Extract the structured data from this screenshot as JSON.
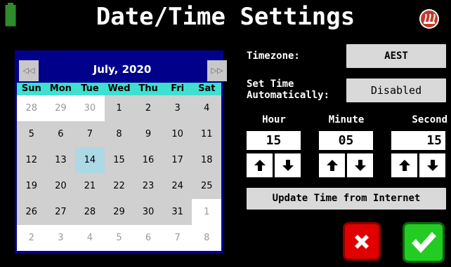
{
  "header": {
    "title": "Date/Time Settings",
    "battery_icon": "battery-icon",
    "logo_icon": "brand-logo-icon"
  },
  "calendar": {
    "month_label": "July, 2020",
    "prev_icon": "chevrons-left-icon",
    "next_icon": "chevrons-right-icon",
    "weekdays": [
      "Sun",
      "Mon",
      "Tue",
      "Wed",
      "Thu",
      "Fri",
      "Sat"
    ],
    "days": [
      {
        "d": "28",
        "other": true
      },
      {
        "d": "29",
        "other": true
      },
      {
        "d": "30",
        "other": true
      },
      {
        "d": "1"
      },
      {
        "d": "2"
      },
      {
        "d": "3"
      },
      {
        "d": "4"
      },
      {
        "d": "5"
      },
      {
        "d": "6"
      },
      {
        "d": "7"
      },
      {
        "d": "8"
      },
      {
        "d": "9"
      },
      {
        "d": "10"
      },
      {
        "d": "11"
      },
      {
        "d": "12"
      },
      {
        "d": "13"
      },
      {
        "d": "14",
        "selected": true
      },
      {
        "d": "15"
      },
      {
        "d": "16"
      },
      {
        "d": "17"
      },
      {
        "d": "18"
      },
      {
        "d": "19"
      },
      {
        "d": "20"
      },
      {
        "d": "21"
      },
      {
        "d": "22"
      },
      {
        "d": "23"
      },
      {
        "d": "24"
      },
      {
        "d": "25"
      },
      {
        "d": "26"
      },
      {
        "d": "27"
      },
      {
        "d": "28"
      },
      {
        "d": "29"
      },
      {
        "d": "30"
      },
      {
        "d": "31"
      },
      {
        "d": "1",
        "other": true
      },
      {
        "d": "2",
        "other": true
      },
      {
        "d": "3",
        "other": true
      },
      {
        "d": "4",
        "other": true
      },
      {
        "d": "5",
        "other": true
      },
      {
        "d": "6",
        "other": true
      },
      {
        "d": "7",
        "other": true
      },
      {
        "d": "8",
        "other": true
      }
    ]
  },
  "settings": {
    "timezone_label": "Timezone:",
    "timezone_value": "AEST",
    "auto_label_line1": "Set Time",
    "auto_label_line2": "Automatically:",
    "auto_value": "Disabled",
    "hour_label": "Hour",
    "minute_label": "Minute",
    "second_label": "Second",
    "hour_value": "15",
    "minute_value": "05",
    "second_value": "15",
    "update_button": "Update Time from Internet"
  },
  "actions": {
    "cancel_icon": "x-icon",
    "confirm_icon": "checkmark-icon"
  },
  "colors": {
    "calendar_header": "#00008b",
    "weekday_band": "#40e0d0",
    "selected_day": "#add8e6",
    "cancel": "#e00000",
    "confirm": "#22cc22"
  }
}
